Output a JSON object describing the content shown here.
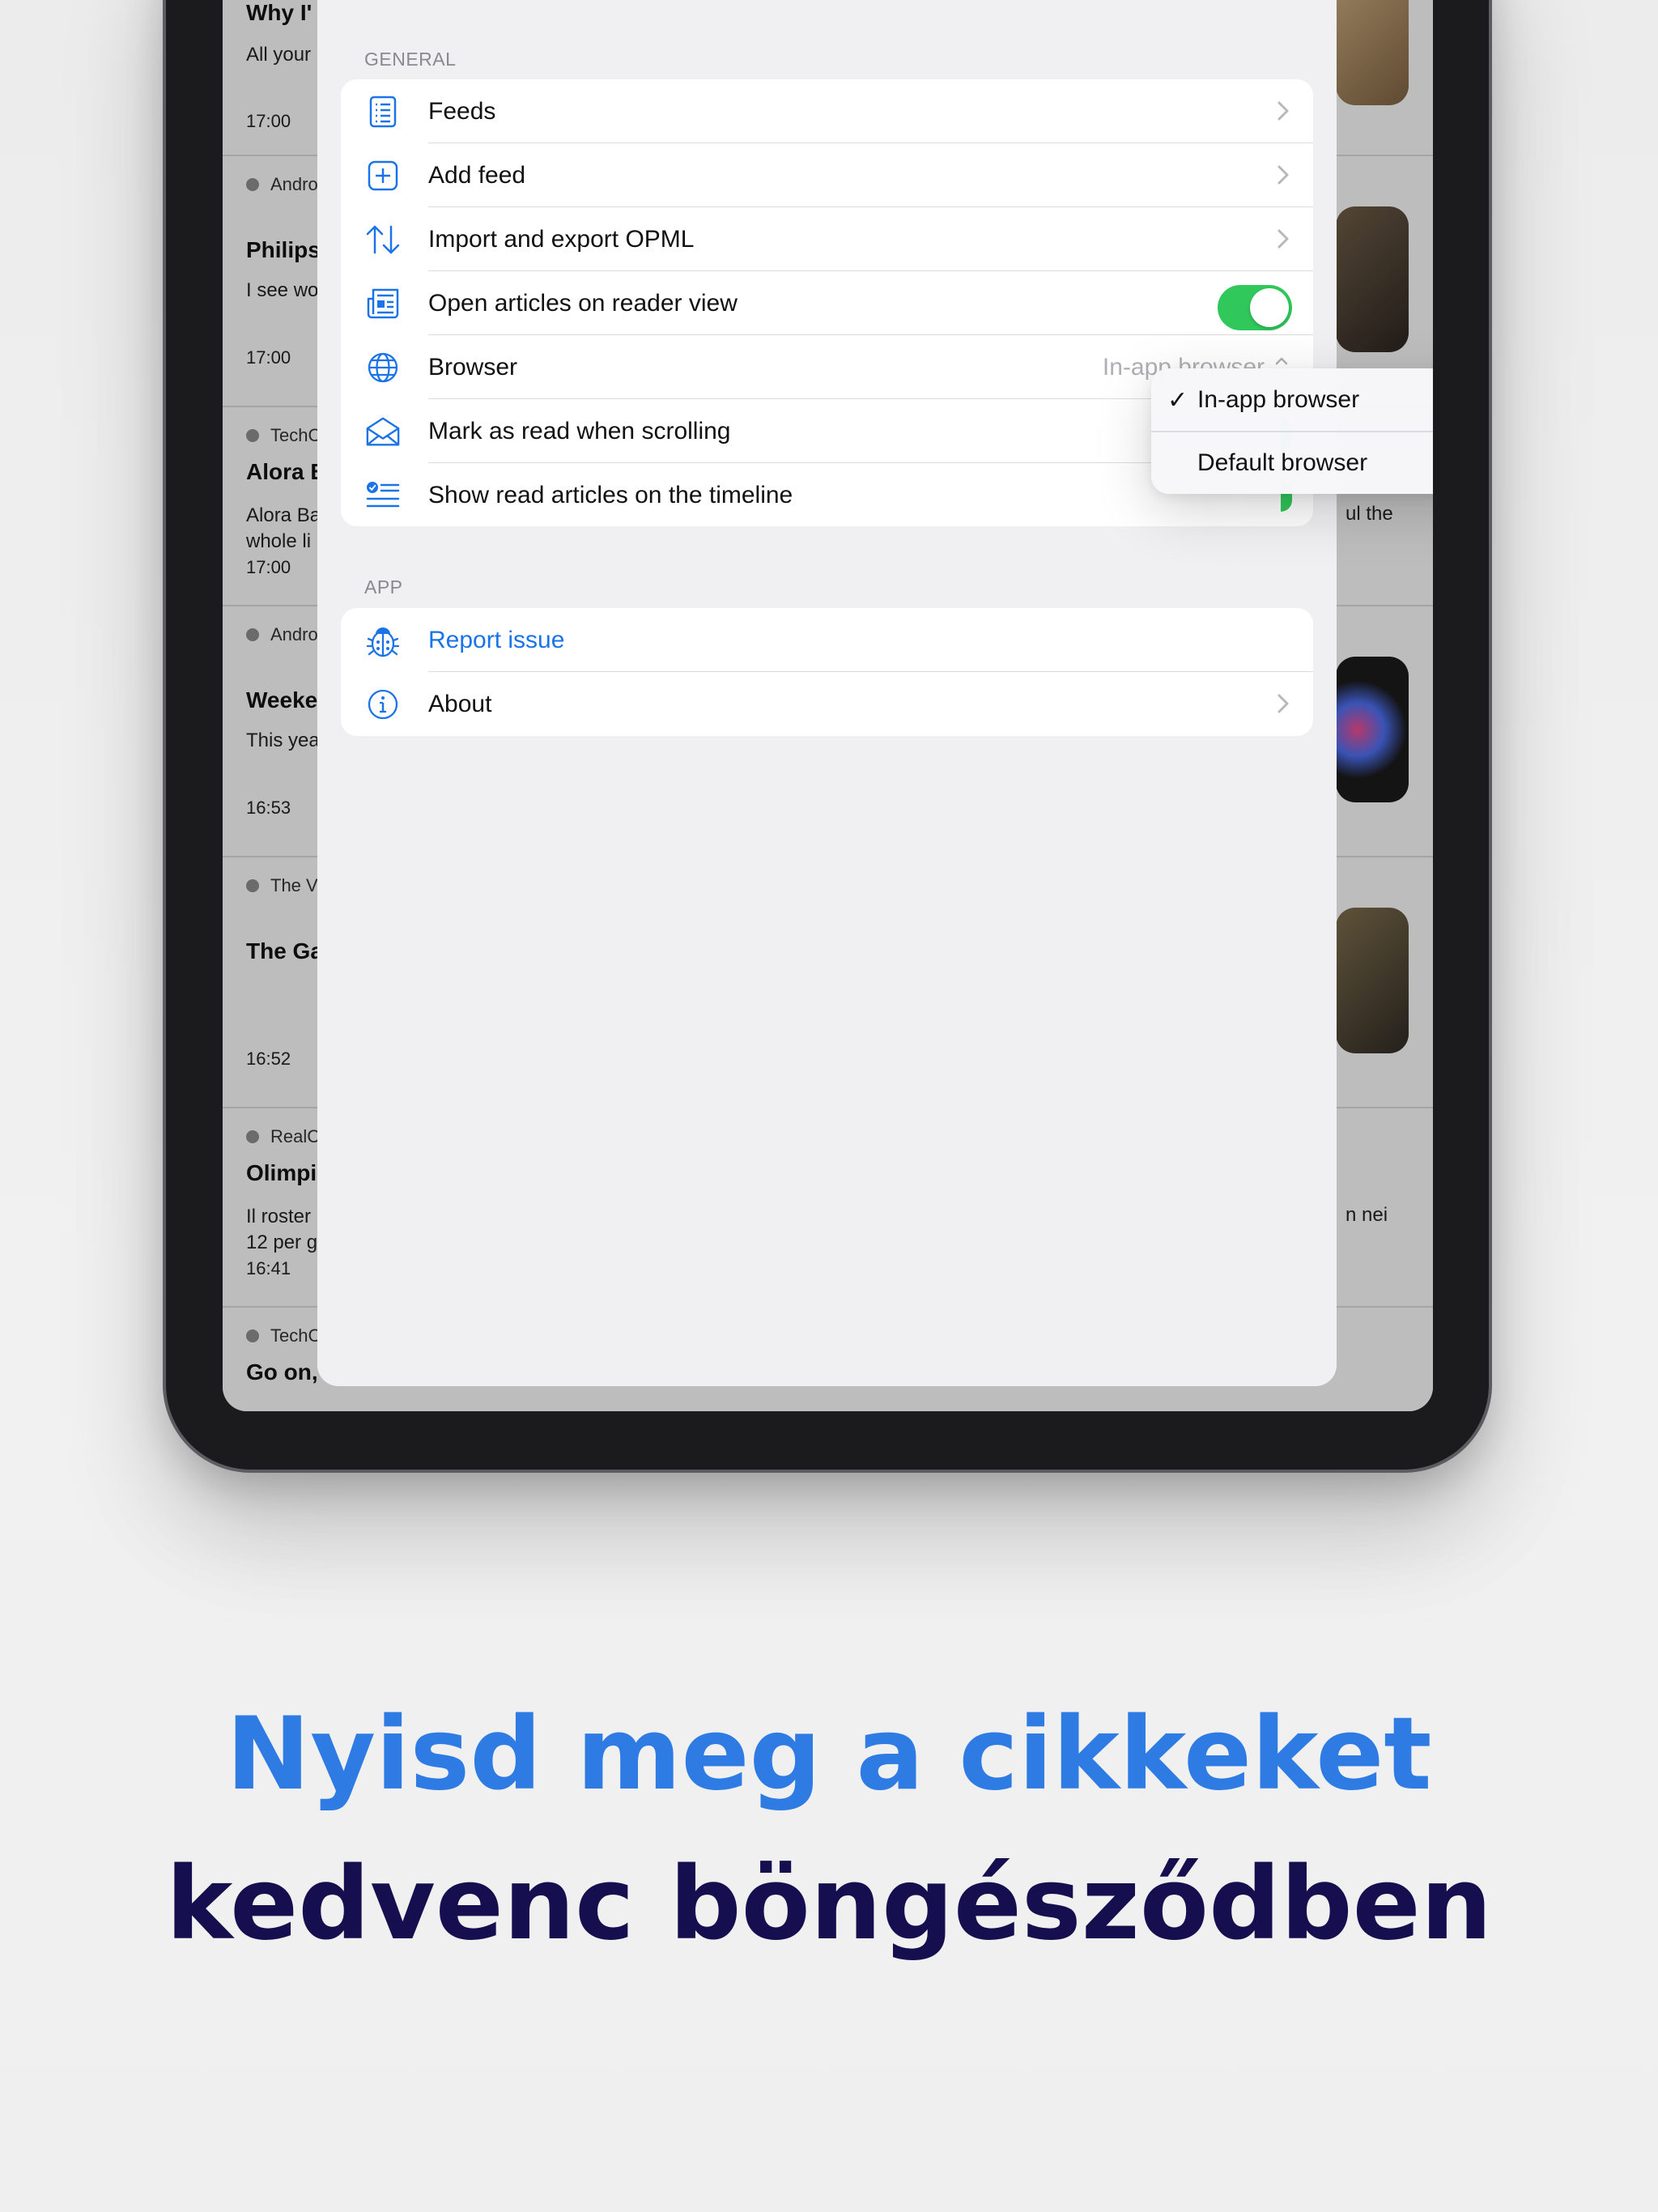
{
  "background_feed": {
    "items": [
      {
        "title": "Why I'",
        "snippet": "All your",
        "time": "17:00"
      },
      {
        "source": "Andro",
        "title": "Philips",
        "snippet": "I see wo",
        "time": "17:00"
      },
      {
        "source": "TechC",
        "title": "Alora B",
        "snippet": "Alora Ba",
        "snippet2": "whole li",
        "right_text": "ul the",
        "time": "17:00"
      },
      {
        "source": "Andro",
        "title": "Weeke",
        "snippet": "This yea",
        "time": "16:53"
      },
      {
        "source": "The V",
        "title": "The Ga",
        "time": "16:52"
      },
      {
        "source": "RealC",
        "title": "Olimpi",
        "snippet": "Il roster",
        "snippet2": "12 per g",
        "right_text": "n nei",
        "time": "16:41"
      },
      {
        "source": "TechC",
        "title": "Go on,"
      }
    ]
  },
  "settings": {
    "general_header": "GENERAL",
    "general_rows": [
      {
        "label": "Feeds",
        "icon": "list-icon",
        "accessory": "chevron"
      },
      {
        "label": "Add feed",
        "icon": "plus-square-icon",
        "accessory": "chevron"
      },
      {
        "label": "Import and export OPML",
        "icon": "arrows-updown-icon",
        "accessory": "chevron"
      },
      {
        "label": "Open articles on reader view",
        "icon": "newspaper-icon",
        "accessory": "toggle",
        "toggle_on": true
      },
      {
        "label": "Browser",
        "icon": "globe-icon",
        "accessory": "select",
        "value": "In-app browser"
      },
      {
        "label": "Mark as read when scrolling",
        "icon": "envelope-open-icon",
        "accessory": "toggle",
        "toggle_on": true
      },
      {
        "label": "Show read articles on the timeline",
        "icon": "checklist-icon",
        "accessory": "toggle",
        "toggle_on": true
      }
    ],
    "app_header": "APP",
    "app_rows": [
      {
        "label": "Report issue",
        "icon": "ladybug-icon",
        "accessory": "none"
      },
      {
        "label": "About",
        "icon": "info-icon",
        "accessory": "chevron"
      }
    ]
  },
  "browser_menu": {
    "options": [
      "In-app browser",
      "Default browser"
    ],
    "selected": "In-app browser",
    "check_glyph": "✓"
  },
  "caption": {
    "line1": "Nyisd meg a cikkeket",
    "line2": "kedvenc böngésződben"
  },
  "colors": {
    "accent": "#1a73e8",
    "toggle_on": "#30c85a",
    "caption_line1": "#2f7be4",
    "caption_line2": "#150f4f"
  }
}
